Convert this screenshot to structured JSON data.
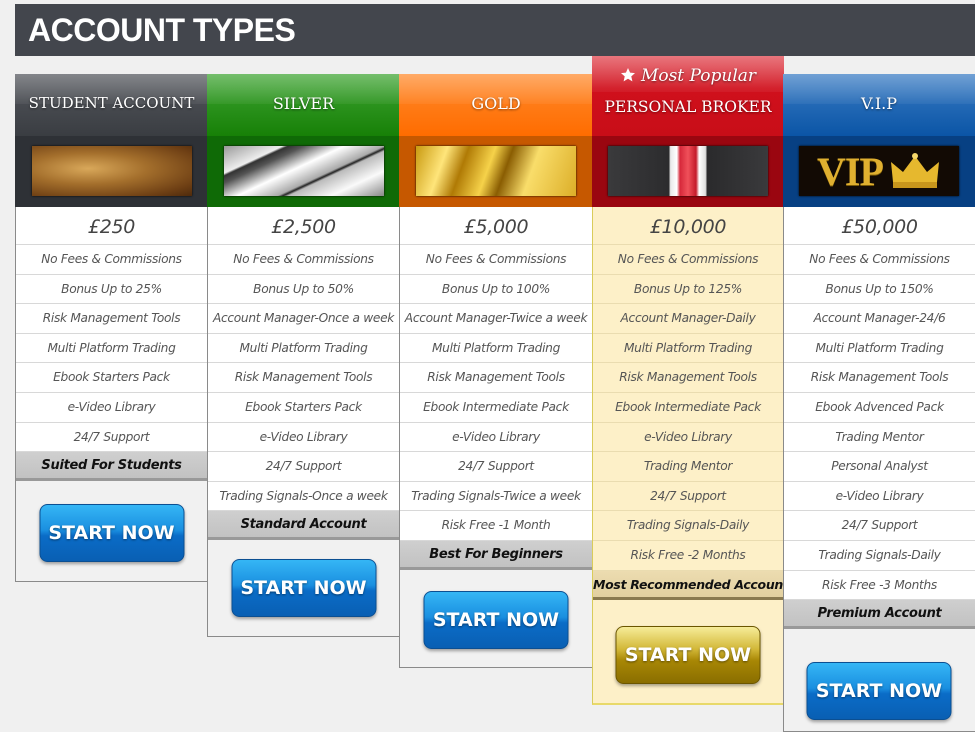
{
  "page": {
    "title": "ACCOUNT TYPES"
  },
  "plans": [
    {
      "name": "STUDENT ACCOUNT",
      "image": "bronze-texture-image",
      "price": "£250",
      "features": [
        "No Fees & Commissions",
        "Bonus Up to 25%",
        "Risk Management Tools",
        "Multi Platform Trading",
        "Ebook Starters Pack",
        "e-Video Library",
        "24/7 Support"
      ],
      "tagline": "Suited For Students",
      "cta": "START NOW"
    },
    {
      "name": "SILVER",
      "image": "silver-metal-image",
      "price": "£2,500",
      "features": [
        "No Fees & Commissions",
        "Bonus Up to 50%",
        "Account Manager-Once a week",
        "Multi Platform Trading",
        "Risk Management Tools",
        "Ebook Starters Pack",
        "e-Video Library",
        "24/7 Support",
        "Trading Signals-Once a week"
      ],
      "tagline": "Standard Account",
      "cta": "START NOW"
    },
    {
      "name": "GOLD",
      "image": "gold-bars-image",
      "price": "£5,000",
      "features": [
        "No Fees & Commissions",
        "Bonus Up to 100%",
        "Account Manager-Twice a week",
        "Multi Platform Trading",
        "Risk Management Tools",
        "Ebook Intermediate Pack",
        "e-Video Library",
        "24/7 Support",
        "Trading Signals-Twice a week",
        "Risk Free -1 Month"
      ],
      "tagline": "Best For Beginners",
      "cta": "START NOW"
    },
    {
      "name": "PERSONAL BROKER",
      "badge": "Most Popular",
      "badge_icon": "star-icon",
      "image": "suit-and-tie-image",
      "price": "£10,000",
      "features": [
        "No Fees & Commissions",
        "Bonus Up to 125%",
        "Account Manager-Daily",
        "Multi Platform Trading",
        "Risk Management Tools",
        "Ebook Intermediate Pack",
        "e-Video Library",
        "Trading Mentor",
        "24/7 Support",
        "Trading Signals-Daily",
        "Risk Free -2 Months"
      ],
      "tagline": "Most Recommended Account",
      "cta": "START NOW"
    },
    {
      "name": "V.I.P",
      "image": "vip-crown-image",
      "image_text": "VIP",
      "price": "£50,000",
      "features": [
        "No Fees & Commissions",
        "Bonus Up to 150%",
        "Account Manager-24/6",
        "Multi Platform Trading",
        "Risk Management Tools",
        "Ebook Advenced Pack",
        "Trading Mentor",
        "Personal Analyst",
        "e-Video Library",
        "24/7 Support",
        "Trading Signals-Daily",
        "Risk Free -3 Months"
      ],
      "tagline": "Premium Account",
      "cta": "START NOW"
    }
  ],
  "colors": {
    "banner": "#43464d",
    "student": "#3a3d42",
    "silver": "#1a8a0c",
    "gold": "#ff6c00",
    "personal": "#d0101c",
    "vip": "#0b55a6",
    "highlight_bg": "#fdf0c8",
    "cta_blue": "#1a8fe0",
    "cta_gold": "#b89a14"
  }
}
